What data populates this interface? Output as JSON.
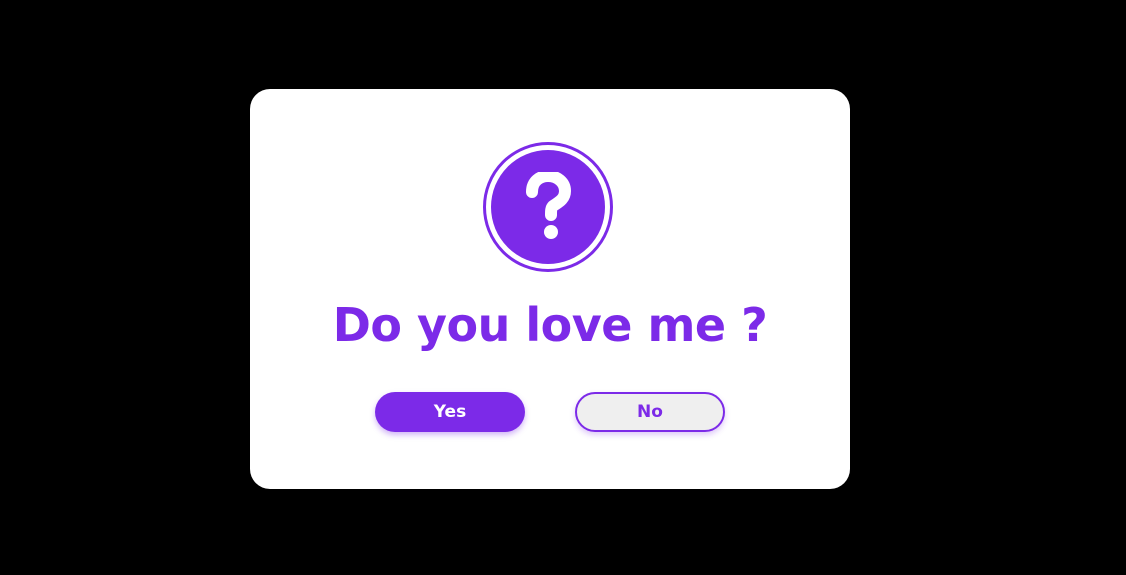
{
  "dialog": {
    "icon": "question-mark-icon",
    "title": "Do you love me ?",
    "buttons": {
      "yes_label": "Yes",
      "no_label": "No"
    }
  },
  "colors": {
    "background": "#000000",
    "dialog": "#ffffff",
    "accent": "#7c2ae8",
    "no_button_fill": "#efefef"
  }
}
